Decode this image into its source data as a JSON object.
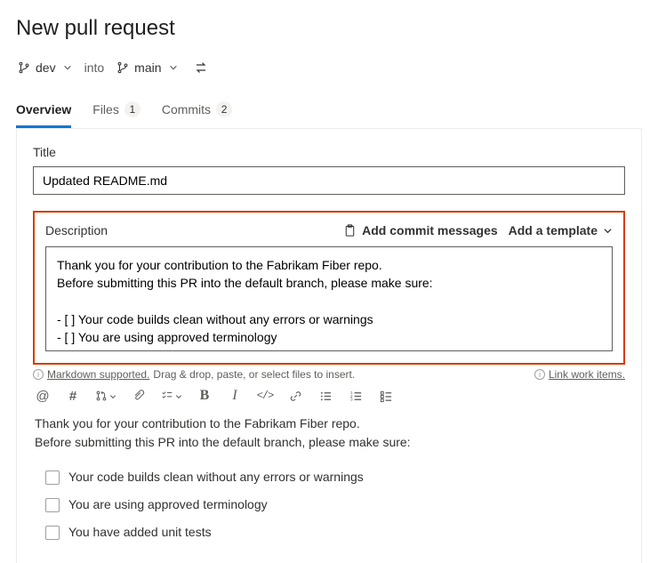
{
  "page_title": "New pull request",
  "branches": {
    "source": "dev",
    "into": "into",
    "target": "main"
  },
  "tabs": {
    "overview": "Overview",
    "files": {
      "label": "Files",
      "count": "1"
    },
    "commits": {
      "label": "Commits",
      "count": "2"
    }
  },
  "title_section": {
    "label": "Title",
    "value": "Updated README.md"
  },
  "description_section": {
    "label": "Description",
    "add_commit_messages": "Add commit messages",
    "add_template": "Add a template",
    "value": "Thank you for your contribution to the Fabrikam Fiber repo.\nBefore submitting this PR into the default branch, please make sure:\n\n- [ ] Your code builds clean without any errors or warnings\n- [ ] You are using approved terminology\n- [ ] You have added unit tests"
  },
  "helper": {
    "markdown_supported": "Markdown supported.",
    "drag_drop": "Drag & drop, paste, or select files to insert.",
    "link_work_items": "Link work items."
  },
  "preview": {
    "intro_line1": "Thank you for your contribution to the Fabrikam Fiber repo.",
    "intro_line2": "Before submitting this PR into the default branch, please make sure:",
    "checklist": [
      "Your code builds clean without any errors or warnings",
      "You are using approved terminology",
      "You have added unit tests"
    ]
  }
}
